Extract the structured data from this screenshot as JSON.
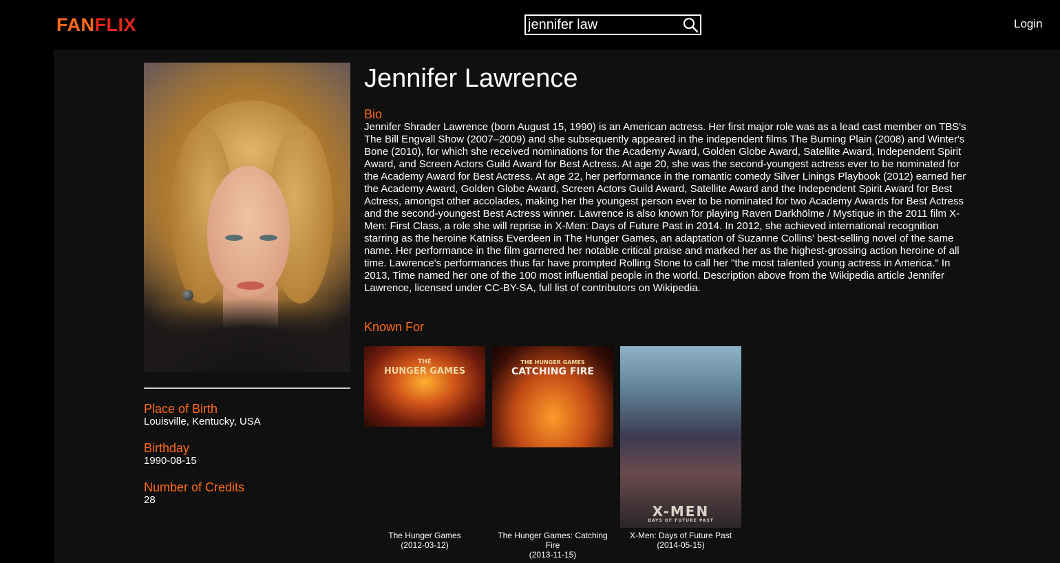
{
  "header": {
    "logo_part1": "FAN",
    "logo_part2": "FLIX",
    "search_value": "jennifer law",
    "login_label": "Login"
  },
  "person": {
    "name": "Jennifer Lawrence",
    "bio_label": "Bio",
    "bio": "Jennifer Shrader Lawrence (born August 15, 1990) is an American actress.   Her first major role was as a lead cast member on TBS's The Bill Engvall Show (2007–2009) and she subsequently appeared in the independent films The Burning Plain (2008) and Winter's Bone (2010), for which she received nominations for the Academy Award, Golden Globe Award, Satellite Award, Independent Spirit Award, and Screen Actors Guild Award for Best Actress. At age 20, she was the second-youngest actress ever to be nominated for the Academy Award for Best Actress. At age 22, her performance in the romantic comedy Silver Linings Playbook (2012) earned her the Academy Award, Golden Globe Award, Screen Actors Guild Award, Satellite Award and the Independent Spirit Award for Best Actress, amongst other accolades, making her the youngest person ever to be nominated for two Academy Awards for Best Actress and the second-youngest Best Actress winner. Lawrence is also known for playing Raven Darkhölme / Mystique in the 2011 film X-Men: First Class, a role she will reprise in X-Men: Days of Future Past in 2014. In 2012, she achieved international recognition starring as the heroine Katniss Everdeen in The Hunger Games, an adaptation of Suzanne Collins' best-selling novel of the same name. Her performance in the film garnered her notable critical praise and marked her as the highest-grossing action heroine of all time. Lawrence's performances thus far have prompted Rolling Stone to call her \"the most talented young actress in America.\" In 2013, Time named her one of the 100 most influential people in the world. Description above from the Wikipedia article Jennifer Lawrence, licensed under CC-BY-SA, full list of contributors on Wikipedia.",
    "place_of_birth_label": "Place of Birth",
    "place_of_birth": "Louisville, Kentucky, USA",
    "birthday_label": "Birthday",
    "birthday": "1990-08-15",
    "credits_label": "Number of Credits",
    "credits": "28"
  },
  "known_for": {
    "label": "Known For",
    "items": [
      {
        "title": "The Hunger Games",
        "date": "(2012-03-12)",
        "poster_line1": "THE",
        "poster_line2": "HUNGER GAMES"
      },
      {
        "title": "The Hunger Games: Catching Fire",
        "date": "(2013-11-15)",
        "poster_line1": "THE HUNGER GAMES",
        "poster_line2": "CATCHING FIRE"
      },
      {
        "title": "X-Men: Days of Future Past",
        "date": "(2014-05-15)",
        "poster_line1": "X-MEN",
        "poster_line2": "DAYS OF FUTURE PAST"
      }
    ]
  },
  "colors": {
    "accent": "#ff6a1a",
    "logo_red": "#e8241c",
    "panel": "#101010",
    "background": "#000000"
  },
  "icons": {
    "search": "search-icon"
  }
}
